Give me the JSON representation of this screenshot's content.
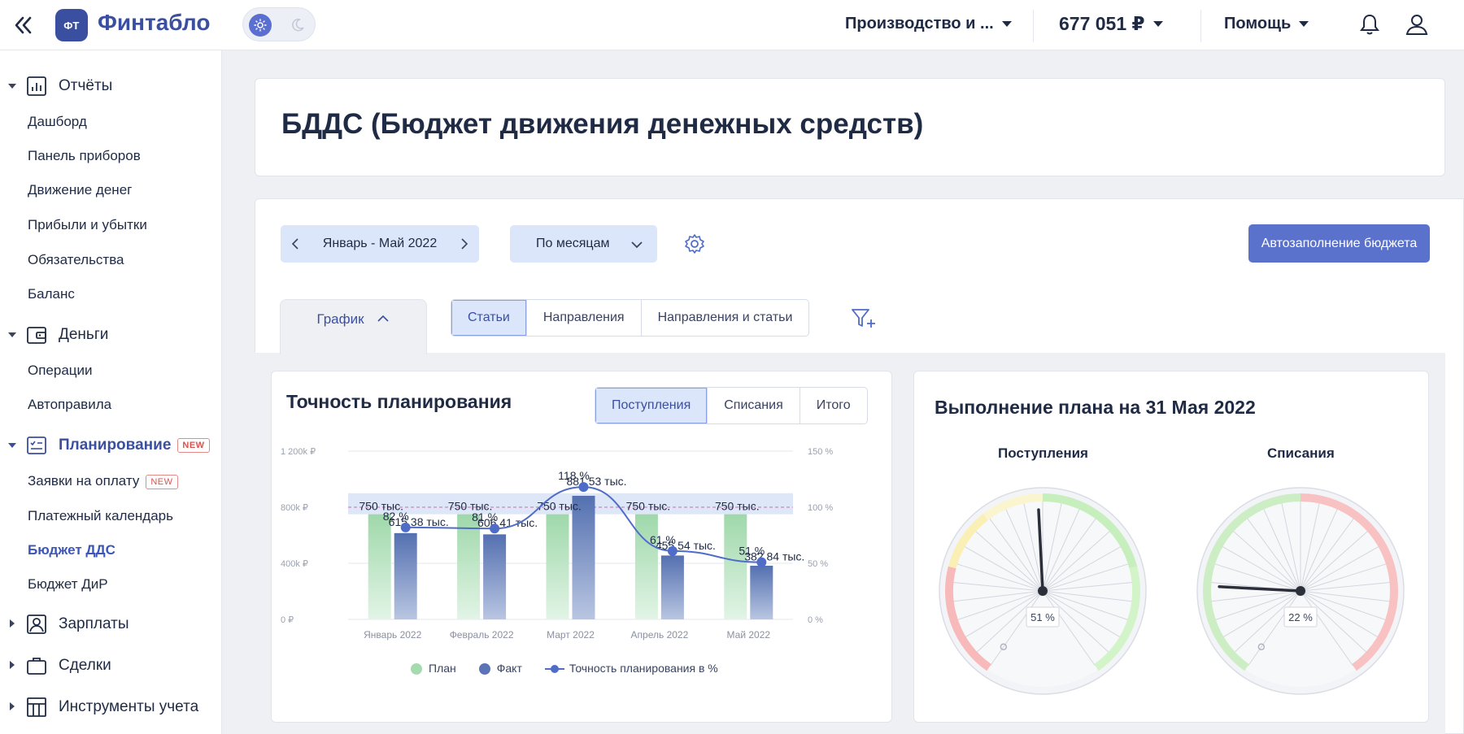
{
  "header": {
    "logo_badge": "ФТ",
    "logo_text": "Финтабло",
    "company_select": "Производство и ...",
    "balance": "677 051 ₽",
    "help": "Помощь"
  },
  "sidebar": {
    "groups": [
      {
        "label": "Отчёты",
        "items": [
          "Дашборд",
          "Панель приборов",
          "Движение денег",
          "Прибыли и убытки",
          "Обязательства",
          "Баланс"
        ]
      },
      {
        "label": "Деньги",
        "items": [
          "Операции",
          "Автоправила"
        ]
      },
      {
        "label": "Планирование",
        "badge": "NEW",
        "items": [
          "Заявки на оплату",
          "Платежный календарь",
          "Бюджет ДДС",
          "Бюджет ДиР"
        ],
        "item_badge": "NEW"
      },
      {
        "label": "Зарплаты"
      },
      {
        "label": "Сделки"
      },
      {
        "label": "Инструменты учета"
      }
    ]
  },
  "page": {
    "title": "БДДС (Бюджет движения денежных средств)",
    "date_range": "Январь - Май 2022",
    "grouping": "По месяцам",
    "autofill_button": "Автозаполнение бюджета",
    "graph_tab": "График",
    "view_tabs": [
      "Статьи",
      "Направления",
      "Направления и статьи"
    ]
  },
  "accuracy_card": {
    "title": "Точность планирования",
    "tabs": [
      "Поступления",
      "Списания",
      "Итого"
    ],
    "legend": [
      "План",
      "Факт",
      "Точность планирования в %"
    ]
  },
  "plan_card": {
    "title": "Выполнение плана на 31 Мая 2022",
    "gauges": [
      {
        "label": "Поступления",
        "value": "51 %",
        "percent": 51
      },
      {
        "label": "Списания",
        "value": "22 %",
        "percent": 22
      }
    ]
  },
  "colors": {
    "accent": "#3b4fa0",
    "plan": "#a6dbb0",
    "fact": "#5a74b5",
    "accuracy": "#4f6cc8"
  },
  "chart_data": {
    "type": "bar",
    "categories": [
      "Январь 2022",
      "Февраль 2022",
      "Март 2022",
      "Апрель 2022",
      "Май 2022"
    ],
    "series": [
      {
        "name": "План",
        "values": [
          750000,
          750000,
          750000,
          750000,
          750000
        ],
        "labels": [
          "750 тыс.",
          "750 тыс.",
          "750 тыс.",
          "750 тыс.",
          "750 тыс."
        ]
      },
      {
        "name": "Факт",
        "values": [
          615380,
          606410,
          881530,
          455540,
          382840
        ],
        "labels": [
          "615 38 тыс.",
          "606 41 тыс.",
          "881 53 тыс.",
          "455 54 тыс.",
          "382 84 тыс."
        ]
      },
      {
        "name": "Точность планирования в %",
        "type": "line",
        "axis": "right",
        "values": [
          82,
          81,
          118,
          61,
          51
        ],
        "labels": [
          "82 %",
          "81 %",
          "118 %",
          "61 %",
          "51 %"
        ]
      }
    ],
    "y_left": {
      "min": 0,
      "max": 1200000,
      "ticks": [
        "0 ₽",
        "400k ₽",
        "800k ₽",
        "1 200k ₽"
      ],
      "tick_values": [
        0,
        400000,
        800000,
        1200000
      ]
    },
    "y_right": {
      "min": 0,
      "max": 150,
      "ticks": [
        "0 %",
        "50 %",
        "100 %",
        "150 %"
      ],
      "tick_values": [
        0,
        50,
        100,
        150
      ]
    },
    "band": {
      "from": 750000,
      "to": 900000
    },
    "legend_position": "bottom"
  }
}
